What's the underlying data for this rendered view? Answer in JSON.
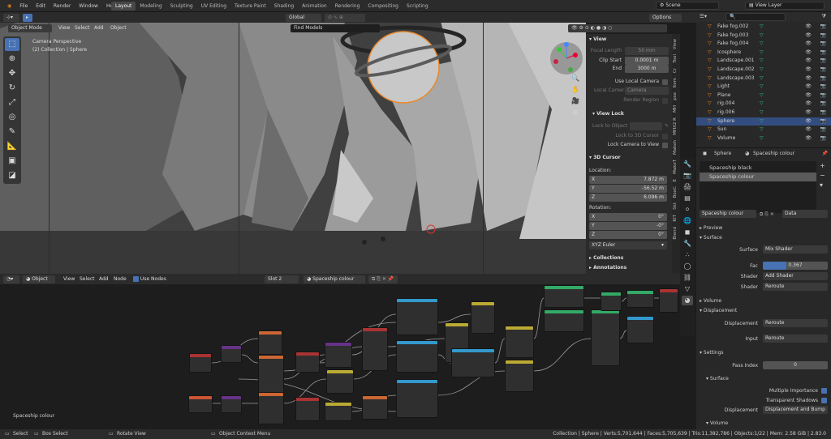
{
  "menu": [
    "File",
    "Edit",
    "Render",
    "Window",
    "Help"
  ],
  "workspaces": [
    "Layout",
    "Modeling",
    "Sculpting",
    "UV Editing",
    "Texture Paint",
    "Shading",
    "Animation",
    "Rendering",
    "Compositing",
    "Scripting"
  ],
  "active_workspace": "Layout",
  "scene": "Scene",
  "view_layer": "View Layer",
  "viewport": {
    "mode": "Object Mode",
    "menus": [
      "View",
      "Select",
      "Add",
      "Object"
    ],
    "orientation": "Global",
    "collection_filter": "Find Models",
    "options": "Options",
    "overlay_title": "Camera Perspective",
    "overlay_sub": "(2) Collection | Sphere"
  },
  "npanel": {
    "view_header": "View",
    "focal_label": "Focal Length",
    "focal_value": "50 mm",
    "clip_start_label": "Clip Start",
    "clip_start_value": "0.0001 m",
    "end_label": "End",
    "end_value": "3000 m",
    "use_local_camera": "Use Local Camera",
    "local_camera_label": "Local Camera",
    "local_camera_value": "Camera",
    "render_region": "Render Region",
    "view_lock_header": "View Lock",
    "lock_to_object": "Lock to Object",
    "lock_3d_cursor": "Lock to 3D Cursor",
    "lock_camera": "Lock Camera to View",
    "cursor_header": "3D Cursor",
    "location_label": "Location:",
    "x": "X",
    "y": "Y",
    "z": "Z",
    "loc_x": "7.872 m",
    "loc_y": "-56.52 m",
    "loc_z": "6.096 m",
    "rotation_label": "Rotation:",
    "rot_x": "0°",
    "rot_y": "-0°",
    "rot_z": "0°",
    "rotation_mode": "XYZ Euler",
    "collections": "Collections",
    "annotations": "Annotations"
  },
  "vtabs": [
    "View",
    "Tool",
    "Cr",
    "Item",
    "pse",
    "MH",
    "MHX2 R",
    "Makeh",
    "MakeT",
    "E",
    "BooC",
    "Skt",
    "KIT",
    "Blend"
  ],
  "outliner": {
    "search_placeholder": "",
    "rows": [
      {
        "name": "Fake fog.002",
        "selected": false
      },
      {
        "name": "Fake fog.003",
        "selected": false
      },
      {
        "name": "Fake fog.004",
        "selected": false
      },
      {
        "name": "Icosphere",
        "selected": false
      },
      {
        "name": "Landscape.001",
        "selected": false
      },
      {
        "name": "Landscape.002",
        "selected": false
      },
      {
        "name": "Landscape.003",
        "selected": false
      },
      {
        "name": "Light",
        "selected": false
      },
      {
        "name": "Plane",
        "selected": false
      },
      {
        "name": "rig.004",
        "selected": false
      },
      {
        "name": "rig.006",
        "selected": false
      },
      {
        "name": "Sphere",
        "selected": true
      },
      {
        "name": "Sun",
        "selected": false
      },
      {
        "name": "Volume",
        "selected": false
      }
    ]
  },
  "properties": {
    "object": "Sphere",
    "material": "Spaceship colour",
    "slots": [
      "Spaceship black",
      "Spaceship colour"
    ],
    "active_material": "Spaceship colour",
    "link": "Data",
    "preview": "Preview",
    "surface_header": "Surface",
    "surface_label": "Surface",
    "surface_value": "Mix Shader",
    "fac_label": "Fac",
    "fac_value": "0.367",
    "fac_fraction": 0.367,
    "shader1_label": "Shader",
    "shader1_value": "Add Shader",
    "shader2_label": "Shader",
    "shader2_value": "Reroute",
    "volume_header": "Volume",
    "displacement_header": "Displacement",
    "displacement_label": "Displacement",
    "displacement_value": "Reroute",
    "input_label": "Input",
    "input_value": "Reroute",
    "settings_header": "Settings",
    "pass_index_label": "Pass Index",
    "pass_index_value": "0",
    "surface_sub": "Surface",
    "multiple_importance": "Multiple Importance",
    "transparent_shadows": "Transparent Shadows",
    "displacement_sub_label": "Displacement",
    "displacement_sub_value": "Displacement and Bump",
    "volume_sub": "Volume"
  },
  "node_editor": {
    "type": "Object",
    "menus": [
      "View",
      "Select",
      "Add",
      "Node"
    ],
    "use_nodes": "Use Nodes",
    "slot": "Slot 2",
    "material": "Spaceship colour",
    "label": "Spaceship colour"
  },
  "status": {
    "select": "Select",
    "box_select": "Box Select",
    "rotate_view": "Rotate View",
    "context_menu": "Object Context Menu",
    "stats": "Collection | Sphere | Verts:5,701,644 | Faces:5,705,639 | Tris:11,382,786 | Objects:1/22 | Mem: 2.58 GiB | 2.83.0"
  },
  "colors": {
    "accent": "#4772b3",
    "selected_outline": "#e8892b"
  }
}
